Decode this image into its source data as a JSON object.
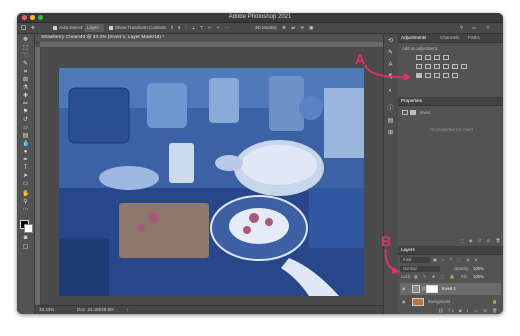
{
  "window": {
    "title": "Adobe Photoshop 2021",
    "document_tab": "Strawberry Cream40 @ 33.3% (Invert 1, Layer Mask/16) *"
  },
  "options_bar": {
    "auto_select": "Auto-Select:",
    "auto_select_value": "Layer",
    "transform_controls": "Show Transform Controls",
    "mode_3d": "3D Mode:"
  },
  "status": {
    "zoom": "33.33%",
    "doc_size": "Doc: 24.1M/48.5M"
  },
  "adjustments": {
    "tabs": [
      "Adjustments",
      "Channels",
      "Paths"
    ],
    "add_label": "Add an adjustment"
  },
  "properties": {
    "title": "Properties",
    "selected": "Invert",
    "no_properties": "No properties for Invert"
  },
  "layers": {
    "title": "Layers",
    "kind": "Kind",
    "blend_mode": "Normal",
    "opacity_label": "Opacity:",
    "opacity_value": "100%",
    "lock_label": "Lock:",
    "fill_label": "Fill:",
    "fill_value": "100%",
    "items": [
      {
        "name": "Invert 1"
      },
      {
        "name": "Background"
      }
    ]
  },
  "annotations": {
    "a": "A",
    "b": "B"
  },
  "colors": {
    "accent": "#e0306e",
    "photo_tint": "#3a63a8"
  }
}
